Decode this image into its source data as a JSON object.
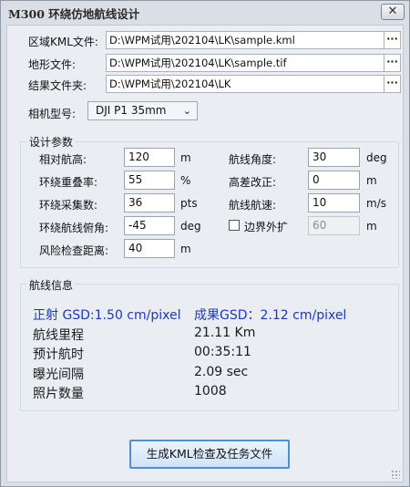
{
  "window": {
    "title": "M300 环绕仿地航线设计",
    "close_glyph": "✕"
  },
  "files": {
    "kml_label": "区域KML文件:",
    "kml_value": "D:\\WPM试用\\202104\\LK\\sample.kml",
    "terrain_label": "地形文件:",
    "terrain_value": "D:\\WPM试用\\202104\\LK\\sample.tif",
    "result_label": "结果文件夹:",
    "result_value": "D:\\WPM试用\\202104\\LK",
    "browse_glyph": "···"
  },
  "camera": {
    "label": "相机型号:",
    "value": "DJI P1 35mm",
    "chevron": "⌄"
  },
  "params": {
    "title": "设计参数",
    "rel_height": {
      "label": "相对航高:",
      "value": "120",
      "unit": "m"
    },
    "overlap": {
      "label": "环绕重叠率:",
      "value": "55",
      "unit": "%"
    },
    "sample_count": {
      "label": "环绕采集数:",
      "value": "36",
      "unit": "pts"
    },
    "pitch": {
      "label": "环绕航线俯角:",
      "value": "-45",
      "unit": "deg"
    },
    "risk_dist": {
      "label": "风险检查距离:",
      "value": "40",
      "unit": "m"
    },
    "route_angle": {
      "label": "航线角度:",
      "value": "30",
      "unit": "deg"
    },
    "height_fix": {
      "label": "高差改正:",
      "value": "0",
      "unit": "m"
    },
    "speed": {
      "label": "航线航速:",
      "value": "10",
      "unit": "m/s"
    },
    "boundary": {
      "label": "边界外扩",
      "value": "60",
      "unit": "m",
      "checked": false
    }
  },
  "info": {
    "title": "航线信息",
    "gsd_ortho": "正射 GSD:1.50 cm/pixel",
    "gsd_result": "成果GSD：2.12 cm/pixel",
    "mileage_label": "航线里程",
    "mileage_value": "21.11 Km",
    "time_label": "预计航时",
    "time_value": "00:35:11",
    "interval_label": "曝光间隔",
    "interval_value": "2.09 sec",
    "photos_label": "照片数量",
    "photos_value": "1008"
  },
  "actions": {
    "generate_label": "生成KML检查及任务文件"
  }
}
